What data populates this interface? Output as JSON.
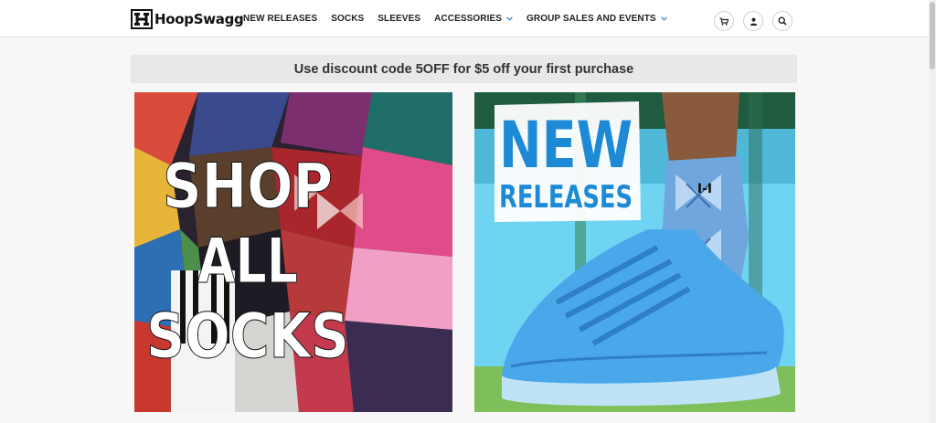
{
  "header": {
    "logo_text": "HoopSwagg",
    "nav": [
      {
        "label": "NEW RELEASES"
      },
      {
        "label": "SOCKS"
      },
      {
        "label": "SLEEVES"
      },
      {
        "label": "ACCESSORIES"
      },
      {
        "label": "GROUP SALES AND EVENTS"
      }
    ],
    "icons": [
      "cart-icon",
      "user-icon",
      "search-icon"
    ]
  },
  "promo": {
    "text": "Use discount code 5OFF for $5 off your first purchase"
  },
  "tiles": {
    "left": {
      "line1": "SHOP",
      "line2": "ALL",
      "line3": "SOCKS"
    },
    "right": {
      "line1": "NEW",
      "line2": "RELEASES"
    }
  },
  "colors": {
    "accent": "#3b86c6",
    "new_releases_blue": "#1e8ad6",
    "sneaker_blue": "#4aa8ea"
  }
}
